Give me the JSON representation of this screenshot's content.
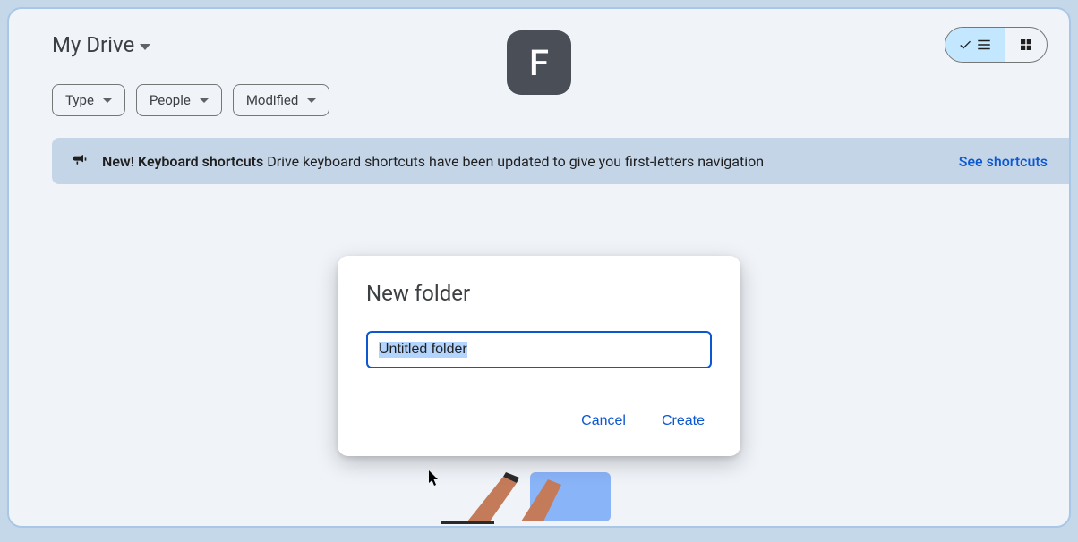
{
  "breadcrumb": {
    "title": "My Drive"
  },
  "key_hint": "F",
  "filters": {
    "type": "Type",
    "people": "People",
    "modified": "Modified"
  },
  "banner": {
    "bold": "New! Keyboard shortcuts",
    "rest": " Drive keyboard shortcuts have been updated to give you first-letters navigation",
    "link": "See shortcuts"
  },
  "dialog": {
    "title": "New folder",
    "input_value": "Untitled folder",
    "cancel": "Cancel",
    "create": "Create"
  }
}
